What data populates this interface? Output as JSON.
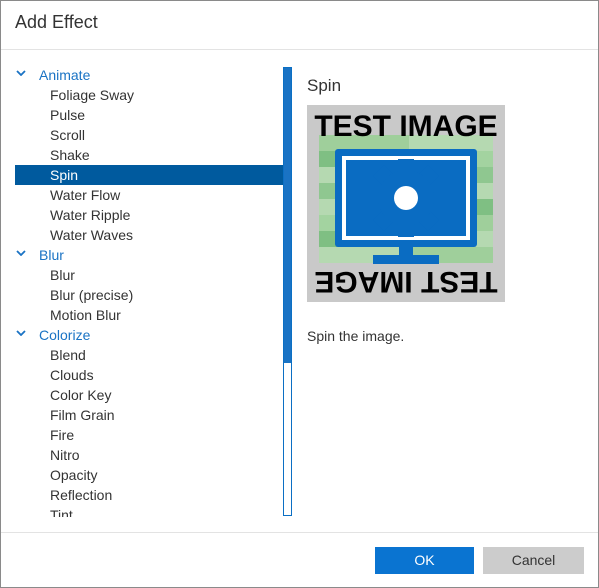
{
  "dialog": {
    "title": "Add Effect"
  },
  "tree": {
    "categories": [
      {
        "label": "Animate",
        "items": [
          "Foliage Sway",
          "Pulse",
          "Scroll",
          "Shake",
          "Spin",
          "Water Flow",
          "Water Ripple",
          "Water Waves"
        ]
      },
      {
        "label": "Blur",
        "items": [
          "Blur",
          "Blur (precise)",
          "Motion Blur"
        ]
      },
      {
        "label": "Colorize",
        "items": [
          "Blend",
          "Clouds",
          "Color Key",
          "Film Grain",
          "Fire",
          "Nitro",
          "Opacity",
          "Reflection",
          "Tint"
        ]
      }
    ],
    "selected": "Spin"
  },
  "preview": {
    "title": "Spin",
    "image_text": "TEST IMAGE",
    "description": "Spin the image."
  },
  "buttons": {
    "ok": "OK",
    "cancel": "Cancel"
  },
  "colors": {
    "accent": "#0a74d1",
    "selection": "#005a9e",
    "category": "#1a73c4"
  }
}
